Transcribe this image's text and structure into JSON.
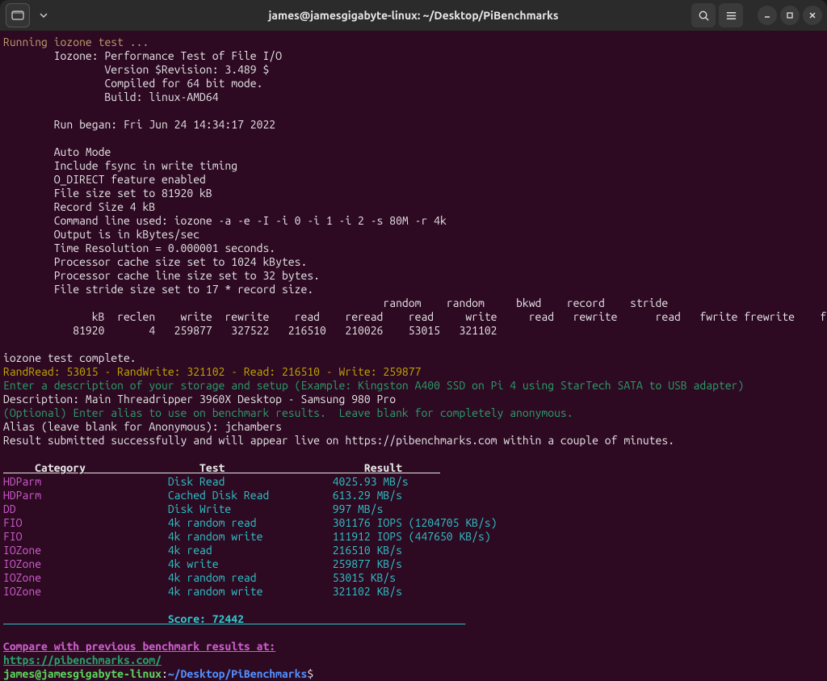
{
  "window": {
    "title": "james@jamesgigabyte-linux: ~/Desktop/PiBenchmarks"
  },
  "iozone": {
    "running": "Running iozone test ...",
    "header": "        Iozone: Performance Test of File I/O",
    "version": "                Version $Revision: 3.489 $",
    "compiled": "                Compiled for 64 bit mode.",
    "build": "                Build: linux-AMD64",
    "runbegan": "        Run began: Fri Jun 24 14:34:17 2022",
    "automode": "        Auto Mode",
    "fsync": "        Include fsync in write timing",
    "odirect": "        O_DIRECT feature enabled",
    "filesize": "        File size set to 81920 kB",
    "recsize": "        Record Size 4 kB",
    "cmdline": "        Command line used: iozone -a -e -I -i 0 -i 1 -i 2 -s 80M -r 4k",
    "outputis": "        Output is in kBytes/sec",
    "timeres": "        Time Resolution = 0.000001 seconds.",
    "pcache": "        Processor cache size set to 1024 kBytes.",
    "pcacheln": "        Processor cache line size set to 32 bytes.",
    "stride": "        File stride size set to 17 * record size.",
    "colhdr1": "                                                            random    random     bkwd    record    stride",
    "colhdr2": "              kB  reclen    write  rewrite    read    reread    read     write     read   rewrite      read   fwrite frewrite    fread  freread",
    "datarow": "           81920       4   259877   327522   216510   210026    53015   321102",
    "complete": "iozone test complete."
  },
  "summary": {
    "randline": "RandRead: 53015 - RandWrite: 321102 - Read: 216510 - Write: 259877",
    "descprompt": "Enter a description of your storage and setup (Example: Kingston A400 SSD on Pi 4 using StarTech SATA to USB adapter)",
    "descline": "Description: Main Threadripper 3960X Desktop - Samsung 980 Pro",
    "aliasprompt": "(Optional) Enter alias to use on benchmark results.  Leave blank for completely anonymous.",
    "aliasline": "Alias (leave blank for Anonymous): jchambers",
    "submitted": "Result submitted successfully and will appear live on https://pibenchmarks.com within a couple of minutes."
  },
  "table": {
    "header": "     Category                  Test                      Result      ",
    "rows": [
      {
        "cat": "HDParm                    ",
        "test": "Disk Read                 ",
        "res": "4025.93 MB/s"
      },
      {
        "cat": "HDParm                    ",
        "test": "Cached Disk Read          ",
        "res": "613.29 MB/s"
      },
      {
        "cat": "DD                        ",
        "test": "Disk Write                ",
        "res": "997 MB/s"
      },
      {
        "cat": "FIO                       ",
        "test": "4k random read            ",
        "res": "301176 IOPS (1204705 KB/s)"
      },
      {
        "cat": "FIO                       ",
        "test": "4k random write           ",
        "res": "111912 IOPS (447650 KB/s)"
      },
      {
        "cat": "IOZone                    ",
        "test": "4k read                   ",
        "res": "216510 KB/s"
      },
      {
        "cat": "IOZone                    ",
        "test": "4k write                  ",
        "res": "259877 KB/s"
      },
      {
        "cat": "IOZone                    ",
        "test": "4k random read            ",
        "res": "53015 KB/s"
      },
      {
        "cat": "IOZone                    ",
        "test": "4k random write           ",
        "res": "321102 KB/s"
      }
    ],
    "score": "                          Score: 72442                                   "
  },
  "footer": {
    "compare": "Compare with previous benchmark results at:",
    "url": "https://pibenchmarks.com/"
  },
  "prompt": {
    "user": "james@jamesgigabyte-linux",
    "colon": ":",
    "path": "~/Desktop/PiBenchmarks",
    "dollar": "$"
  }
}
